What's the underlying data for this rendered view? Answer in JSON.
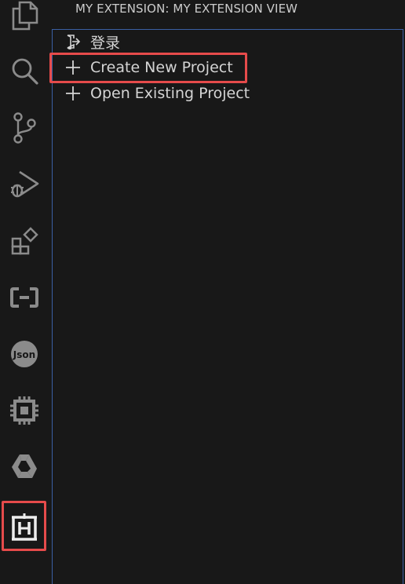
{
  "activity_bar": {
    "items": [
      {
        "name": "explorer-icon"
      },
      {
        "name": "search-icon"
      },
      {
        "name": "source-control-icon"
      },
      {
        "name": "run-debug-icon"
      },
      {
        "name": "extensions-icon"
      },
      {
        "name": "remote-explorer-icon"
      },
      {
        "name": "json-icon"
      },
      {
        "name": "chip-icon"
      },
      {
        "name": "tri-logo-icon"
      },
      {
        "name": "my-extension-icon"
      }
    ]
  },
  "view": {
    "title": "MY EXTENSION: MY EXTENSION VIEW",
    "items": [
      {
        "label": "登录",
        "icon": "sign-in-icon"
      },
      {
        "label": "Create New Project",
        "icon": "plus-icon"
      },
      {
        "label": "Open Existing Project",
        "icon": "plus-icon"
      }
    ]
  },
  "colors": {
    "background": "#181818",
    "text": "#d4d4d4",
    "icon": "#8b8b8b",
    "highlight": "#e64b4b",
    "panel_border": "#3b5fa3"
  }
}
